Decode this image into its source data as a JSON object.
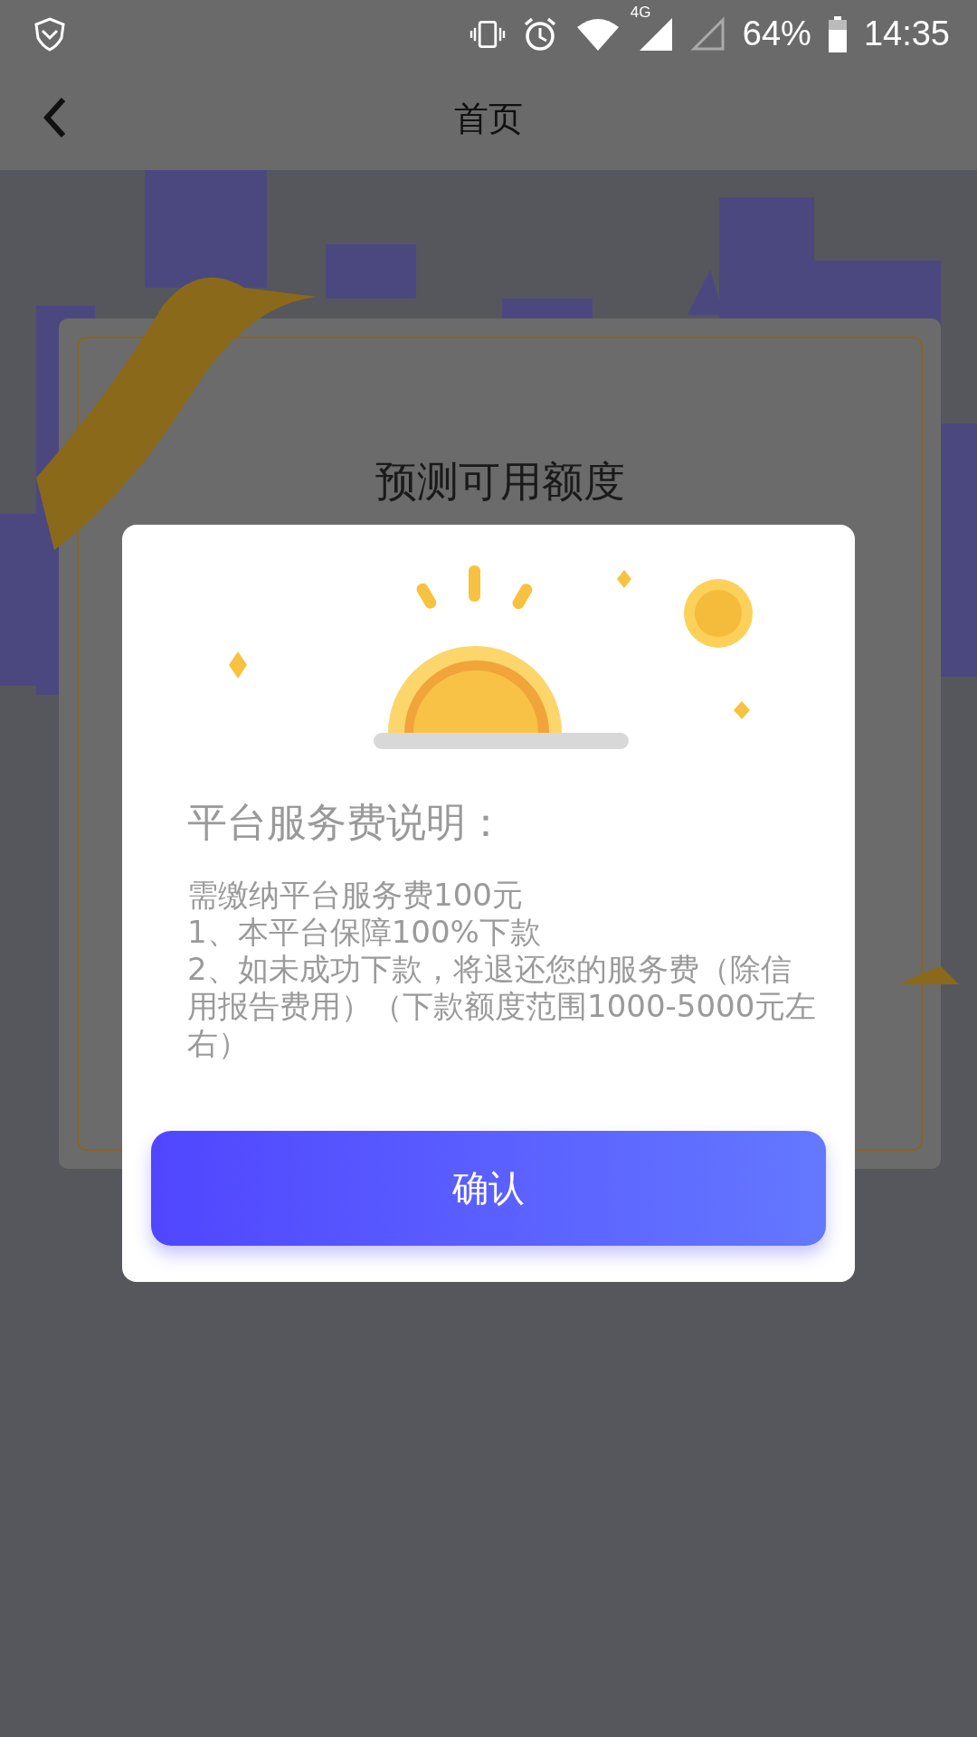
{
  "status_bar": {
    "network": "4G",
    "battery": "64%",
    "time": "14:35"
  },
  "nav": {
    "title": "首页"
  },
  "card": {
    "title": "预测可用额度"
  },
  "dialog": {
    "heading": "平台服务费说明：",
    "lines": [
      "需缴纳平台服务费100元",
      "1、本平台保障100%下款",
      "2、如未成功下款，将退还您的服务费（除信用报告费用）（下款额度范围1000-5000元左右）"
    ],
    "confirm": "确认"
  }
}
